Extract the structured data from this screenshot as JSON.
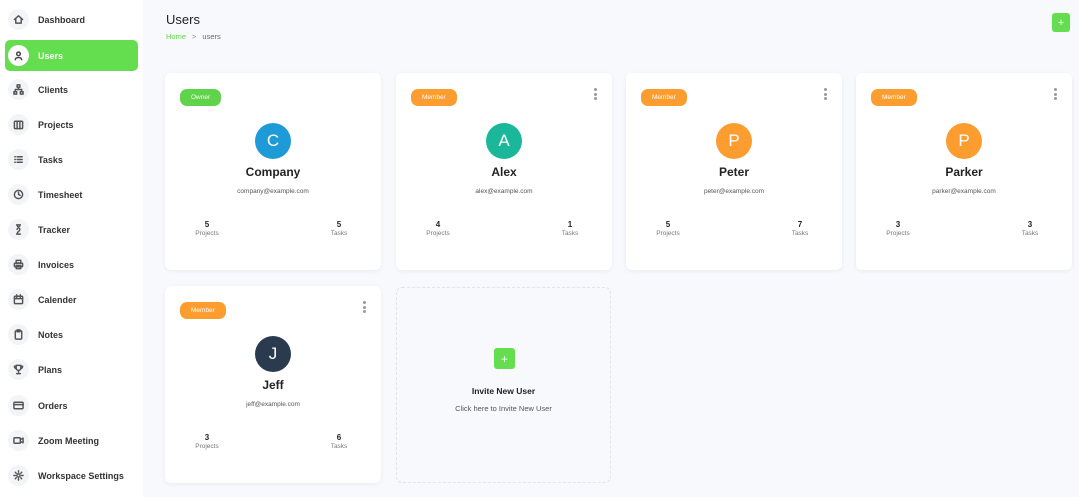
{
  "sidebar": {
    "items": [
      {
        "label": "Dashboard",
        "icon": "home-icon"
      },
      {
        "label": "Users",
        "icon": "user-icon",
        "active": true
      },
      {
        "label": "Clients",
        "icon": "network-icon"
      },
      {
        "label": "Projects",
        "icon": "folder-icon"
      },
      {
        "label": "Tasks",
        "icon": "list-icon"
      },
      {
        "label": "Timesheet",
        "icon": "clock-icon"
      },
      {
        "label": "Tracker",
        "icon": "timer-icon"
      },
      {
        "label": "Invoices",
        "icon": "printer-icon"
      },
      {
        "label": "Calender",
        "icon": "calendar-icon"
      },
      {
        "label": "Notes",
        "icon": "clipboard-icon"
      },
      {
        "label": "Plans",
        "icon": "trophy-icon"
      },
      {
        "label": "Orders",
        "icon": "credit-card-icon"
      },
      {
        "label": "Zoom Meeting",
        "icon": "video-icon"
      },
      {
        "label": "Workspace Settings",
        "icon": "gear-icon"
      }
    ]
  },
  "header": {
    "title": "Users",
    "breadcrumb_home": "Home",
    "breadcrumb_sep": ">",
    "breadcrumb_current": "users",
    "add_label": "+"
  },
  "colors": {
    "accent": "#64dd4f",
    "owner_badge": "#5fd44a",
    "member_badge": "#fd9d2f"
  },
  "users": [
    {
      "role": "Owner",
      "initial": "C",
      "name": "Company",
      "email": "company@example.com",
      "projects": "5",
      "tasks": "5",
      "avatar_color": "#1e9bd7",
      "menu": false
    },
    {
      "role": "Member",
      "initial": "A",
      "name": "Alex",
      "email": "alex@example.com",
      "projects": "4",
      "tasks": "1",
      "avatar_color": "#1bb79a",
      "menu": true
    },
    {
      "role": "Member",
      "initial": "P",
      "name": "Peter",
      "email": "peter@example.com",
      "projects": "5",
      "tasks": "7",
      "avatar_color": "#fd9d2f",
      "menu": true
    },
    {
      "role": "Member",
      "initial": "P",
      "name": "Parker",
      "email": "parker@example.com",
      "projects": "3",
      "tasks": "3",
      "avatar_color": "#fd9d2f",
      "menu": true
    },
    {
      "role": "Member",
      "initial": "J",
      "name": "Jeff",
      "email": "jeff@example.com",
      "projects": "3",
      "tasks": "6",
      "avatar_color": "#2a3a4f",
      "menu": true
    }
  ],
  "stat_labels": {
    "projects": "Projects",
    "tasks": "Tasks"
  },
  "invite": {
    "plus": "+",
    "title": "Invite New User",
    "subtitle": "Click here to Invite New User"
  }
}
